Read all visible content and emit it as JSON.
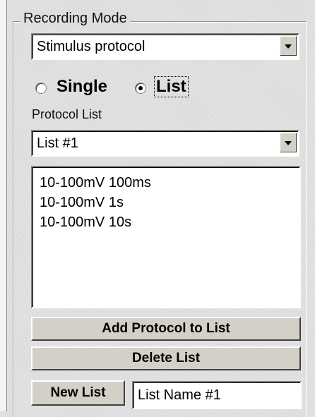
{
  "recording_mode": {
    "group_title": "Recording Mode",
    "mode_selected": "Stimulus protocol"
  },
  "radios": {
    "single_label": "Single",
    "list_label": "List",
    "selected": "List"
  },
  "protocol_list": {
    "label": "Protocol List",
    "selected": "List #1",
    "items": [
      "10-100mV 100ms",
      "10-100mV 1s",
      "10-100mV 10s"
    ]
  },
  "buttons": {
    "add_protocol": "Add Protocol to List",
    "delete_list": "Delete List",
    "new_list": "New List"
  },
  "list_name_input": {
    "value": "List Name #1"
  }
}
